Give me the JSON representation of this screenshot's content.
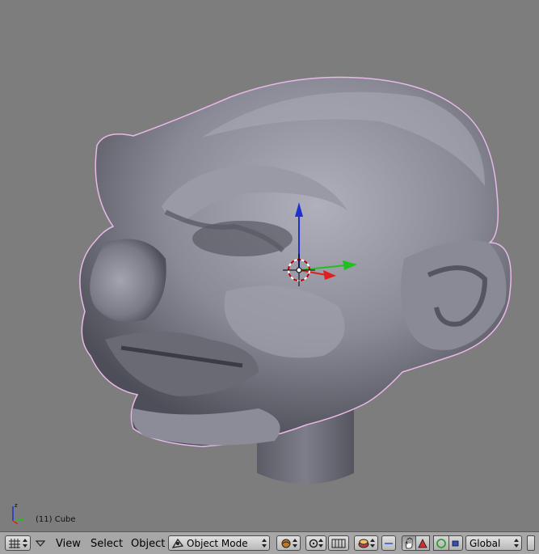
{
  "viewport": {
    "object_label": "(11) Cube"
  },
  "header": {
    "menus": {
      "view": "View",
      "select": "Select",
      "object": "Object"
    },
    "mode_select": {
      "value": "Object Mode",
      "icon": "object-mode-icon"
    },
    "orientation_select": {
      "value": "Global"
    },
    "icons": {
      "editor_type": "grid-icon",
      "menu_toggle": "triangle-down-icon",
      "draw_type": "draw-type-icon",
      "pivot": "pivot-icon",
      "snap": "magnet-icon",
      "layer": "layer-icon",
      "manipulator_hand": "hand-icon",
      "translate": "translate-icon",
      "rotate": "rotate-icon",
      "scale": "scale-icon"
    }
  },
  "colors": {
    "viewport_bg": "#7d7d7d",
    "header_bg": "#a7a7a7",
    "mesh": "#8e8e9a",
    "axis_x": "#e02020",
    "axis_y": "#20c020",
    "axis_z": "#2020e0",
    "selection_outline": "#e8b8e8"
  }
}
